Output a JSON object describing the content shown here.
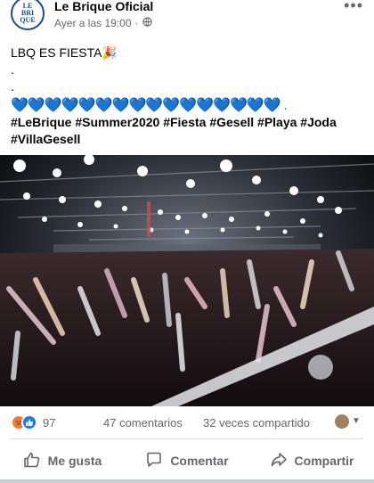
{
  "post": {
    "page_name": "Le Brique Oficial",
    "avatar_text": "LE BRI QUE",
    "timestamp": "Ayer a las 19:00",
    "separator": "·",
    "more_label": "•••",
    "line1": "LBQ ES FIESTA🎉",
    "line2": ".",
    "line3": ".",
    "hearts": "💙💙💙💙💙💙💙💙💙💙💙💙💙💙💙💙 .",
    "hashtags": "#LeBrique #Summer2020 #Fiesta #Gesell #Playa #Joda #VillaGesell"
  },
  "stats": {
    "reaction_count": "97",
    "comments": "47 comentarios",
    "shares": "32 veces compartido"
  },
  "actions": {
    "like": "Me gusta",
    "comment": "Comentar",
    "share": "Compartir"
  },
  "icons": {
    "globe": "globe-icon",
    "like": "thumbs-up-icon",
    "comment": "speech-bubble-icon",
    "share": "share-arrow-icon"
  },
  "colors": {
    "brand_blue": "#1877f2",
    "text_gray": "#65676b"
  }
}
